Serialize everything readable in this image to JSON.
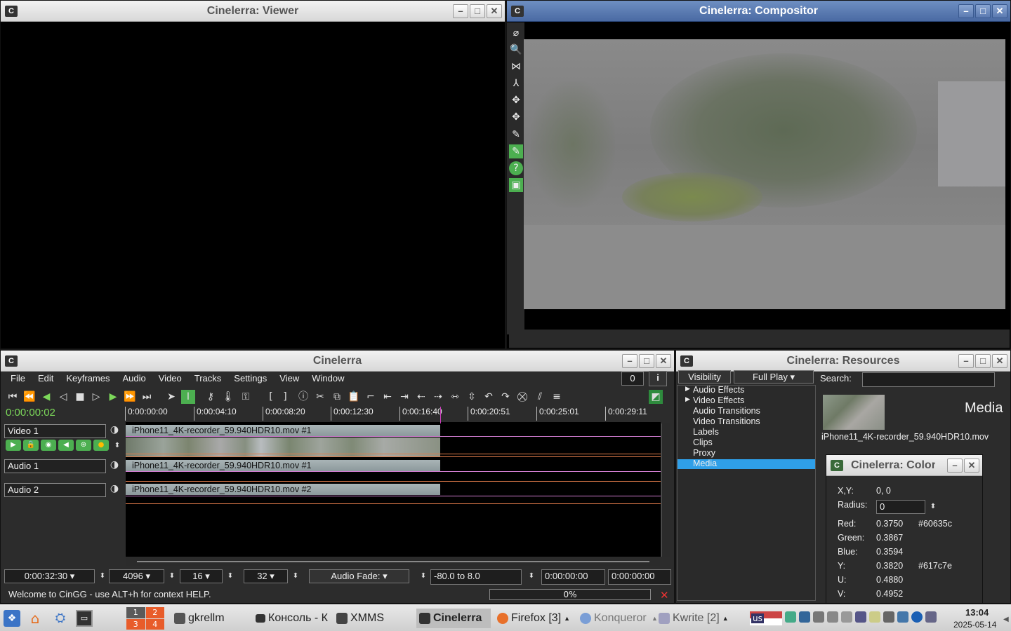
{
  "viewer": {
    "title": "Cinelerra: Viewer"
  },
  "compositor": {
    "title": "Cinelerra: Compositor"
  },
  "main": {
    "title": "Cinelerra",
    "menu": [
      "File",
      "Edit",
      "Keyframes",
      "Audio",
      "Video",
      "Tracks",
      "Settings",
      "View",
      "Window"
    ],
    "counter": "0",
    "info_btn": "i",
    "time": "0:00:00:02",
    "ticks": [
      "0:00:00:00",
      "0:00:04:10",
      "0:00:08:20",
      "0:00:12:30",
      "0:00:16:40",
      "0:00:20:51",
      "0:00:25:01",
      "0:00:29:11"
    ],
    "tracks": [
      {
        "name": "Video 1",
        "clip": "iPhone11_4K-recorder_59.940HDR10.mov #1"
      },
      {
        "name": "Audio 1",
        "clip": "iPhone11_4K-recorder_59.940HDR10.mov #1"
      },
      {
        "name": "Audio 2",
        "clip": "iPhone11_4K-recorder_59.940HDR10.mov #2"
      }
    ],
    "bottom": {
      "duration": "0:00:32:30",
      "samples": "4096",
      "frames": "16",
      "zoom": "32",
      "fade_label": "Audio Fade:",
      "range": "-80.0 to 8.0",
      "t1": "0:00:00:00",
      "t2": "0:00:00:00"
    },
    "status": "Welcome to CinGG - use ALT+h for context HELP.",
    "progress": "0%"
  },
  "resources": {
    "title": "Cinelerra: Resources",
    "visibility": "Visibility",
    "mode": "Full Play",
    "search_label": "Search:",
    "search_value": "",
    "folders": [
      "Audio Effects",
      "Video Effects",
      "Audio Transitions",
      "Video Transitions",
      "Labels",
      "Clips",
      "Proxy",
      "Media"
    ],
    "selected_folder": "Media",
    "heading": "Media",
    "asset": "iPhone11_4K-recorder_59.940HDR10.mov"
  },
  "color": {
    "title": "Cinelerra: Color",
    "xy_label": "X,Y:",
    "xy": "0, 0",
    "radius_label": "Radius:",
    "radius": "0",
    "red_label": "Red:",
    "red": "0.3750",
    "red_hex": "#60635c",
    "green_label": "Green:",
    "green": "0.3867",
    "blue_label": "Blue:",
    "blue": "0.3594",
    "y_label": "Y:",
    "y": "0.3820",
    "y_hex": "#617c7e",
    "u_label": "U:",
    "u": "0.4880",
    "v_label": "V:",
    "v": "0.4952"
  },
  "taskbar": {
    "pager": [
      "1",
      "2",
      "3",
      "4"
    ],
    "items": [
      "gkrellm",
      "Консоль - К",
      "XMMS",
      "Cinelerra",
      "Firefox [3]",
      "Konqueror",
      "Kwrite [2]"
    ],
    "lang": "us",
    "clock": "13:04",
    "date": "2025-05-14"
  },
  "colors": {
    "accent_green": "#7cd85a",
    "selection": "#2f9fe8",
    "titlebar_active": "#5575ad"
  }
}
